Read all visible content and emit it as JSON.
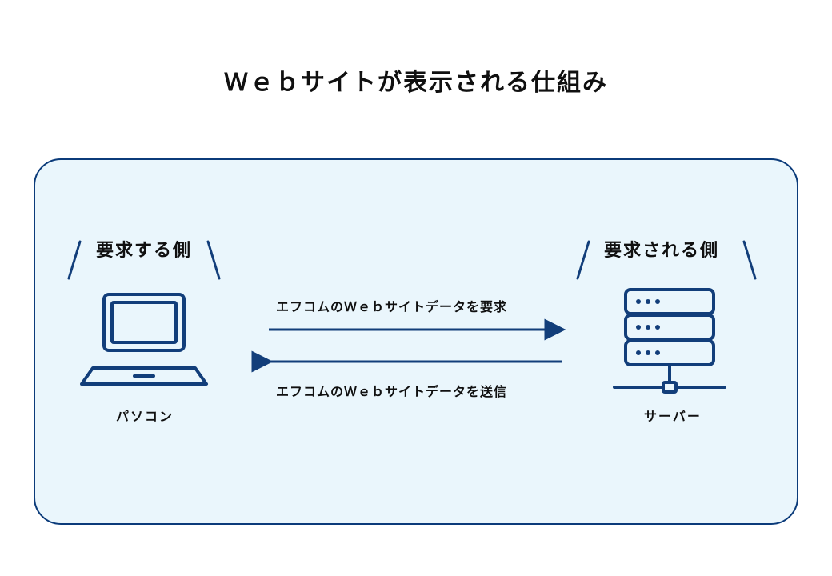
{
  "title": "Ｗｅｂサイトが表示される仕組み",
  "left_role": "要求する側",
  "right_role": "要求される側",
  "left_caption": "パソコン",
  "right_caption": "サーバー",
  "arrow_top_label": "エフコムのＷｅｂサイトデータを要求",
  "arrow_bottom_label": "エフコムのＷｅｂサイトデータを送信",
  "colors": {
    "outline": "#123e7a",
    "panel_bg": "#eaf6fc",
    "text": "#101010"
  },
  "icons": {
    "left": "laptop-icon",
    "right": "server-icon"
  }
}
